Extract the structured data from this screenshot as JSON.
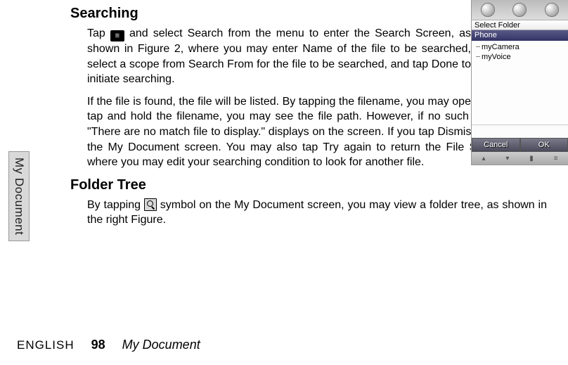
{
  "sideTab": "My Document",
  "heading1": "Searching",
  "para1a_pre": "Tap ",
  "para1a_post": " and select Search from the menu to enter the Search Screen, as shown in Figure 2, where you may enter Name of the file to be searched, select a scope from Search From for the file to be searched, and tap Done to initiate searching.",
  "para1b": "If the file is found, the file will be listed. By tapping the filename, you may open the file; if you tap and hold the filename, you may see the file path. However, if no such a file is found, \"There are no match file to display.\" displays on the screen. If you tap Dismiss, you return to the My Document screen. You may also tap Try again to return the File Search screen, where you may edit your searching condition to look for another file.",
  "heading2": "Folder Tree",
  "para2_pre": "By tapping ",
  "para2_post": " symbol on the My Document screen, you may view a folder tree, as shown in the right Figure.",
  "footer": {
    "lang": "ENGLISH",
    "page": "98",
    "section": "My Document"
  },
  "device": {
    "label": "Select Folder",
    "root": "Phone",
    "items": [
      "myCamera",
      "myVoice"
    ],
    "softLeft": "Cancel",
    "softRight": "OK"
  }
}
